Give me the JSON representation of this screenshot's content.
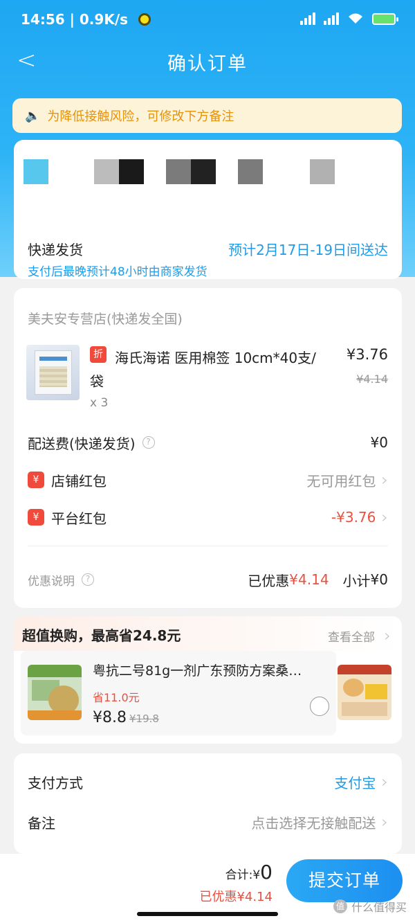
{
  "status_bar": {
    "time": "14:56 | 0.9K/s"
  },
  "header": {
    "back": "<",
    "title": "确认订单"
  },
  "notice": {
    "icon": "speaker-icon",
    "text": "为降低接触风险，可修改下方备注"
  },
  "delivery": {
    "label": "快递发货",
    "eta": "预计2月17日-19日间送达",
    "subtitle": "支付后最晚预计48小时由商家发货"
  },
  "order": {
    "shop": "美夫安专营店(快递发全国)",
    "item": {
      "badge": "折",
      "name": "海氏海诺 医用棉签 10cm*40支/袋",
      "qty": "x 3",
      "price": "¥3.76",
      "original_price": "¥4.14"
    },
    "shipping_label": "配送费(快递发货)",
    "shipping_value": "¥0",
    "store_coupon_label": "店铺红包",
    "store_coupon_value": "无可用红包",
    "platform_coupon_label": "平台红包",
    "platform_coupon_value": "-¥3.76",
    "discount_label": "优惠说明",
    "saved_prefix": "已优惠",
    "saved_value": "¥4.14",
    "subtotal_prefix": "小计",
    "subtotal_value": "¥0"
  },
  "exchange": {
    "title": "超值换购，最高省24.8元",
    "view_all": "查看全部",
    "product": {
      "name": "粤抗二号81g一剂广东预防方案桑…",
      "save": "省11.0元",
      "price": "¥8.8",
      "original_price": "¥19.8"
    }
  },
  "payment": {
    "method_label": "支付方式",
    "method_value": "支付宝",
    "note_label": "备注",
    "note_value": "点击选择无接触配送"
  },
  "footer": {
    "total_prefix": "合计:¥",
    "total_value": "0",
    "saved": "已优惠¥4.14",
    "submit": "提交订单",
    "watermark": "什么值得买"
  },
  "colors": {
    "primary": "#1e9be8",
    "red": "#e9503f",
    "notice_bg": "#fdf3d9",
    "notice_text": "#e5920d"
  }
}
